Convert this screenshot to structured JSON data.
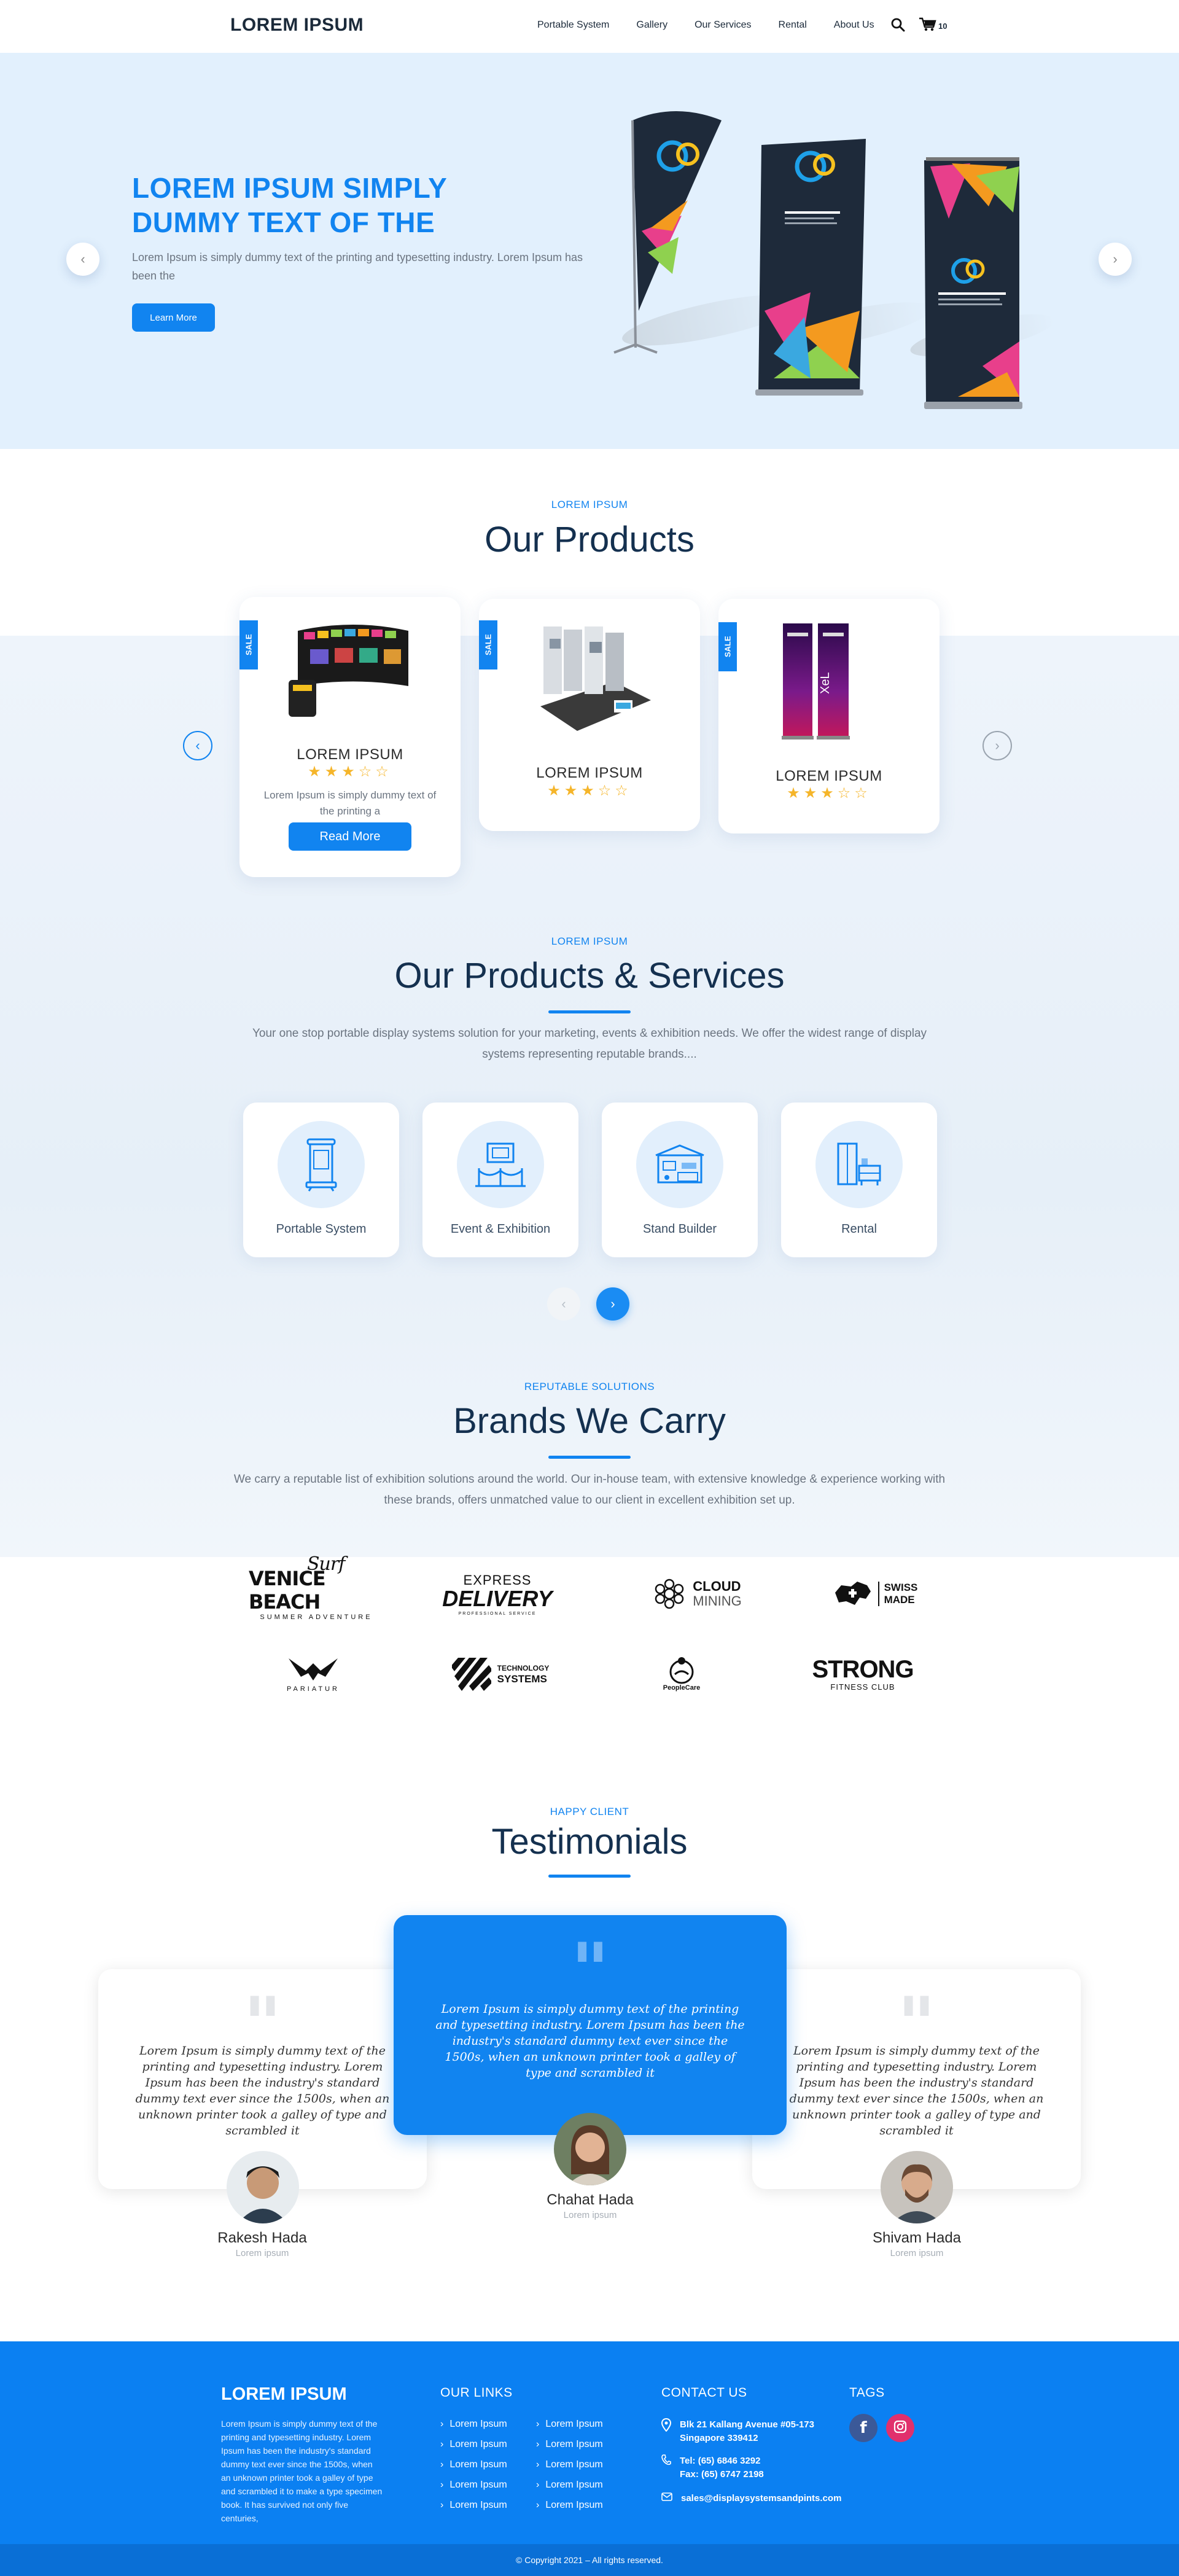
{
  "header": {
    "logo": "LOREM IPSUM",
    "nav": [
      "Portable System",
      "Gallery",
      "Our Services",
      "Rental",
      "About Us"
    ],
    "cart_count": "10"
  },
  "hero": {
    "title_line1": "LOREM IPSUM SIMPLY",
    "title_line2": "DUMMY TEXT OF THE",
    "description": "Lorem Ipsum is simply dummy text of the printing and typesetting industry. Lorem Ipsum has been the",
    "button": "Learn More"
  },
  "products": {
    "eyebrow": "LOREM IPSUM",
    "title": "Our Products",
    "sale_label": "SALE",
    "items": [
      {
        "name": "LOREM IPSUM",
        "rating": 3,
        "desc": "Lorem Ipsum is simply dummy text of the printing a",
        "button": "Read More"
      },
      {
        "name": "LOREM IPSUM",
        "rating": 3
      },
      {
        "name": "LOREM IPSUM",
        "rating": 3
      }
    ]
  },
  "services": {
    "eyebrow": "LOREM IPSUM",
    "title": "Our Products & Services",
    "description": "Your one stop portable display systems solution for your marketing, events & exhibition needs. We offer the widest range of display systems representing reputable brands....",
    "items": [
      "Portable System",
      "Event & Exhibition",
      "Stand Builder",
      "Rental"
    ]
  },
  "brands": {
    "eyebrow": "REPUTABLE SOLUTIONS",
    "title": "Brands We Carry",
    "description": "We carry a reputable list of exhibition solutions around the world. Our in-house team, with extensive knowledge & experience working with these brands, offers unmatched value to our client in excellent exhibition set up.",
    "logos": [
      {
        "main": "VENICE BEACH",
        "script": "Surf",
        "sub": "SUMMER ADVENTURE"
      },
      {
        "main": "DELIVERY",
        "top": "EXPRESS",
        "sub": "PROFESSIONAL SERVICE"
      },
      {
        "main": "CLOUD",
        "sub": "MINING"
      },
      {
        "main": "SWISS",
        "sub": "MADE"
      },
      {
        "main": "PARIATUR"
      },
      {
        "main": "TECHNOLOGY",
        "sub": "SYSTEMS"
      },
      {
        "main": "PeopleCare"
      },
      {
        "main": "STRONG",
        "sub": "FITNESS CLUB"
      }
    ]
  },
  "testimonials": {
    "eyebrow": "HAPPY CLIENT",
    "title": "Testimonials",
    "items": [
      {
        "text": "Lorem Ipsum is simply dummy text of the printing and typesetting industry. Lorem Ipsum has been the industry's standard dummy text ever since the 1500s, when an unknown printer took a galley of type and scrambled it",
        "name": "Rakesh Hada",
        "role": "Lorem ipsum"
      },
      {
        "text": "Lorem Ipsum is simply dummy text of the printing and typesetting industry. Lorem Ipsum has been the industry's standard dummy text ever since the 1500s, when an unknown printer took a galley of type and scrambled it",
        "name": "Chahat Hada",
        "role": "Lorem ipsum"
      },
      {
        "text": "Lorem Ipsum is simply dummy text of the printing and typesetting industry. Lorem Ipsum has been the industry's standard dummy text ever since the 1500s, when an unknown printer took a galley of type and scrambled it",
        "name": "Shivam Hada",
        "role": "Lorem ipsum"
      }
    ]
  },
  "footer": {
    "logo": "LOREM IPSUM",
    "about": "Lorem Ipsum is simply dummy text of the printing and typesetting industry. Lorem Ipsum has been the industry's standard dummy text ever since the 1500s, when an unknown printer took a galley of type and scrambled it to make a type specimen book. It has survived not only five centuries,",
    "links_heading": "OUR LINKS",
    "link_label": "Lorem Ipsum",
    "contact_heading": "CONTACT US",
    "address_line1": "Blk 21 Kallang Avenue #05-173",
    "address_line2": "Singapore 339412",
    "tel": "Tel: (65) 6846 3292",
    "fax": "Fax: (65) 6747 2198",
    "email": "sales@displaysystemsandpints.com",
    "tags_heading": "TAGS",
    "copyright": "© Copyright 2021 – All rights reserved."
  },
  "colors": {
    "accent": "#1184f0",
    "hero_bg": "#e2f0fd",
    "footer_bg": "#0b80f2",
    "star": "#f5b52a",
    "title": "#14304f"
  }
}
